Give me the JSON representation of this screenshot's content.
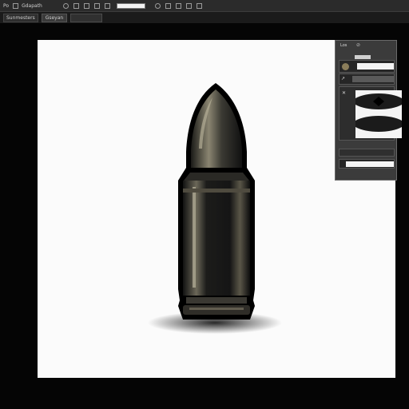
{
  "topbar": {
    "app_label": "Po",
    "menu_label": "Gdapath",
    "icons": [
      "undo-icon",
      "frame-icon",
      "brush-icon",
      "fill-icon",
      "swatch-field",
      "round-icon",
      "layers-icon",
      "grid-icon",
      "square-icon",
      "adjust-icon"
    ]
  },
  "optionbar": {
    "preset_label": "Sunmesters",
    "field_label": "Gseyan"
  },
  "panel": {
    "title": "Los",
    "close_glyph": "⊘"
  },
  "artwork": {
    "subject": "bullet"
  }
}
